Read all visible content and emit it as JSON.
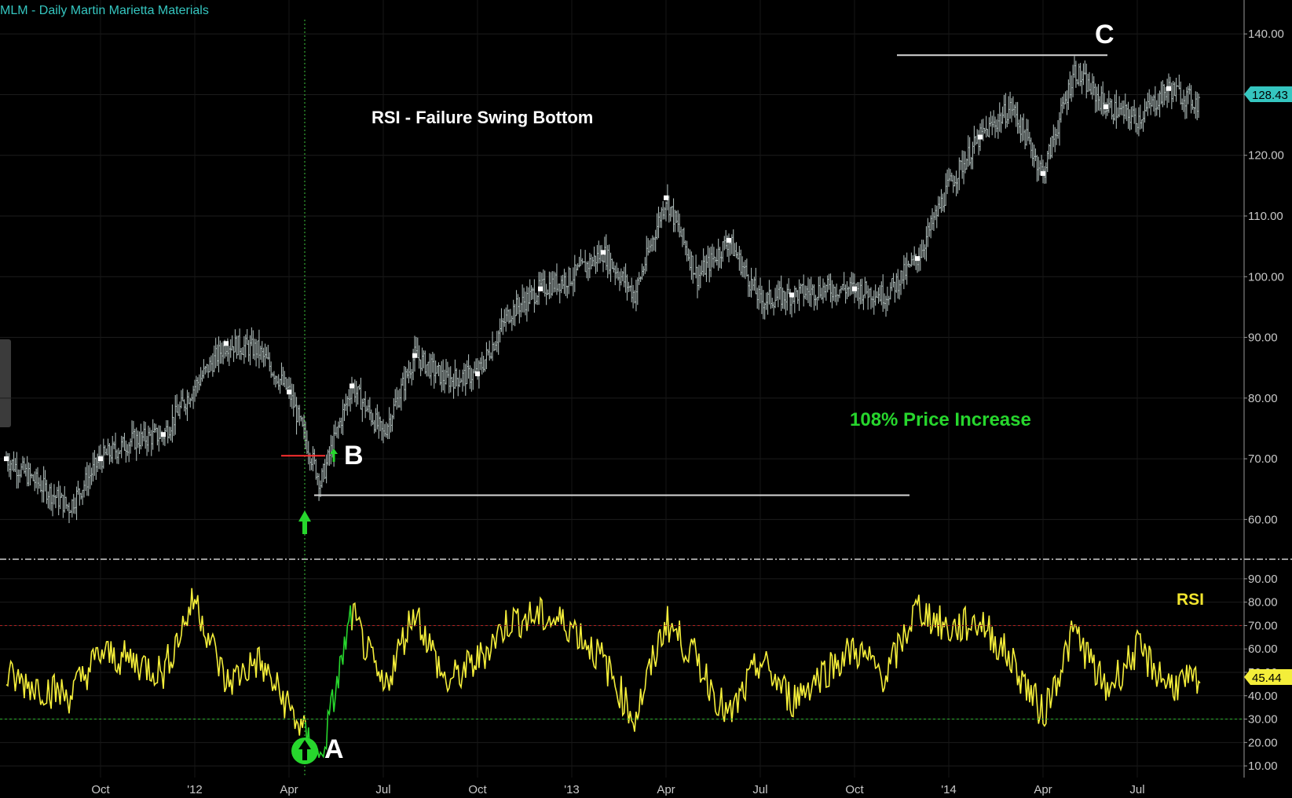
{
  "header": {
    "title": "MLM - Daily  Martin Marietta Materials"
  },
  "colors": {
    "background": "#000000",
    "price_bars": "#a9b6b4",
    "rsi_line": "#f4ee3a",
    "rsi_oversold_segment": "#27d62d",
    "title": "#35c6c0",
    "price_badge": "#35c6c0",
    "rsi_badge": "#f4ee3a",
    "overbought_line": "#b22222",
    "oversold_line": "#2fb02f",
    "resistance_line": "#ff3030",
    "annotation_green": "#27d62d"
  },
  "annotations": {
    "title": "RSI - Failure Swing Bottom",
    "price_increase": "108% Price Increase",
    "point_a": "A",
    "point_b": "B",
    "point_c": "C",
    "rsi_label": "RSI"
  },
  "chart_data": [
    {
      "type": "line",
      "name": "price",
      "subtype": "ohlc-bars",
      "symbol": "MLM",
      "x_tick_labels": [
        "Oct",
        "'12",
        "Apr",
        "Jul",
        "Oct",
        "'13",
        "Apr",
        "Jul",
        "Oct",
        "'14",
        "Apr",
        "Jul"
      ],
      "y_tick_labels": [
        "60.00",
        "70.00",
        "80.00",
        "90.00",
        "100.00",
        "110.00",
        "120.00",
        "130.00",
        "140.00"
      ],
      "ylim": [
        55,
        143
      ],
      "last_value": "128.43",
      "x": [
        "2011-08",
        "2011-10",
        "2011-11",
        "2011-12",
        "2012-01",
        "2012-02",
        "2012-03",
        "2012-04",
        "2012-05",
        "2012-06",
        "2012-07",
        "2012-08",
        "2012-09",
        "2012-10",
        "2012-11",
        "2012-12",
        "2013-01",
        "2013-02",
        "2013-03",
        "2013-04",
        "2013-05",
        "2013-06",
        "2013-07",
        "2013-08",
        "2013-09",
        "2013-10",
        "2013-11",
        "2013-12",
        "2014-01",
        "2014-02",
        "2014-03",
        "2014-04",
        "2014-05",
        "2014-06",
        "2014-07",
        "2014-08",
        "2014-09",
        "2014-10"
      ],
      "close": [
        70,
        62,
        70,
        73,
        74,
        82,
        89,
        88,
        81,
        66,
        82,
        74,
        87,
        83,
        84,
        94,
        98,
        100,
        104,
        97,
        113,
        100,
        106,
        96,
        97,
        98,
        98,
        97,
        103,
        115,
        123,
        128,
        117,
        134,
        128,
        126,
        131,
        128.43
      ],
      "lines": [
        {
          "kind": "resistance",
          "price": 70.5,
          "from": "2012-05",
          "to": "2012-06"
        },
        {
          "kind": "support",
          "price": 64,
          "from": "2012-06",
          "to": "2013-12"
        },
        {
          "kind": "high",
          "price": 136.5,
          "from": "2013-12",
          "to": "2014-06"
        }
      ]
    },
    {
      "type": "line",
      "name": "RSI",
      "y_tick_labels": [
        "10.00",
        "20.00",
        "30.00",
        "40.00",
        "50.00",
        "60.00",
        "70.00",
        "80.00",
        "90.00"
      ],
      "ylim": [
        5,
        95
      ],
      "reference_levels": [
        70,
        30
      ],
      "last_value": "45.44",
      "x": [
        "2011-08",
        "2011-10",
        "2011-11",
        "2011-12",
        "2012-01",
        "2012-02",
        "2012-03",
        "2012-04",
        "2012-05",
        "2012-06",
        "2012-07",
        "2012-08",
        "2012-09",
        "2012-10",
        "2012-11",
        "2012-12",
        "2013-01",
        "2013-02",
        "2013-03",
        "2013-04",
        "2013-05",
        "2013-06",
        "2013-07",
        "2013-08",
        "2013-09",
        "2013-10",
        "2013-11",
        "2013-12",
        "2014-01",
        "2014-02",
        "2014-03",
        "2014-04",
        "2014-05",
        "2014-06",
        "2014-07",
        "2014-08",
        "2014-09",
        "2014-10"
      ],
      "values": [
        48,
        40,
        58,
        55,
        50,
        82,
        45,
        55,
        35,
        12,
        75,
        42,
        77,
        45,
        55,
        72,
        74,
        70,
        55,
        30,
        72,
        55,
        30,
        55,
        38,
        50,
        60,
        48,
        78,
        68,
        72,
        55,
        32,
        68,
        42,
        60,
        45,
        45.44
      ]
    }
  ]
}
